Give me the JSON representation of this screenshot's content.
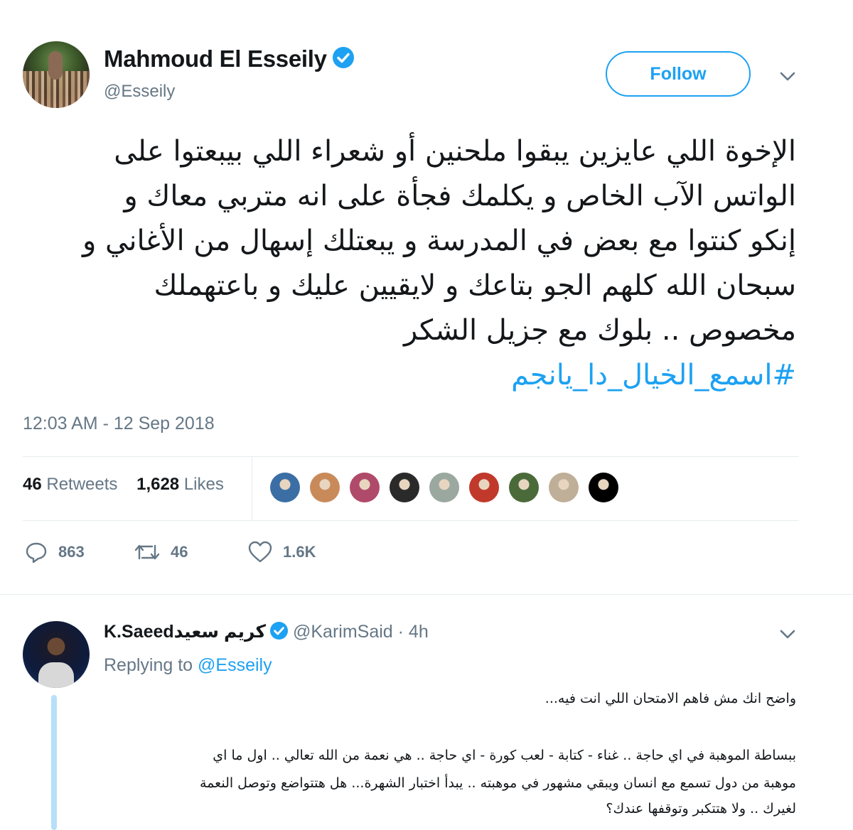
{
  "tweet": {
    "author_name": "Mahmoud El Esseily",
    "author_handle": "@Esseily",
    "follow_label": "Follow",
    "text_lines": [
      "الإخوة اللي عايزين يبقوا ملحنين أو شعراء اللي بيبعتوا على",
      "الواتس الآب الخاص و يكلمك فجأة على انه متربي معاك و",
      "إنكو كنتوا مع بعض في المدرسة و يبعتلك إسهال من الأغاني و",
      "سبحان الله كلهم الجو بتاعك و لايقيين عليك و باعتهملك",
      "مخصوص .. بلوك مع جزيل الشكر"
    ],
    "hashtag": "#اسمع_الخيال_دا_يانجم",
    "timestamp": "12:03 AM - 12 Sep 2018",
    "retweets_count": "46",
    "retweets_label": "Retweets",
    "likes_count": "1,628",
    "likes_label": "Likes",
    "actions": {
      "replies": "863",
      "retweets": "46",
      "likes": "1.6K"
    }
  },
  "likers": [
    {
      "color": "#3b6ea5"
    },
    {
      "color": "#c98a5a"
    },
    {
      "color": "#b04a6a"
    },
    {
      "color": "#2a2a2a"
    },
    {
      "color": "#9aa8a0"
    },
    {
      "color": "#c0392b"
    },
    {
      "color": "#4a6a3a"
    },
    {
      "color": "#bfae98"
    },
    {
      "color": "#000000"
    }
  ],
  "reply": {
    "author_name": "K.Saeedكريم سعيد",
    "author_handle": "@KarimSaid",
    "time": "· 4h",
    "replying_prefix": "Replying to ",
    "replying_handle": "@Esseily",
    "line1": "واضح انك مش فاهم الامتحان اللي انت فيه...",
    "line2": "ببساطة الموهبة في اي حاجة .. غناء - كتابة - لعب كورة - اي حاجة .. هي نعمة من الله تعالي .. اول ما اي",
    "line3": "موهبة من دول تسمع مع انسان ويبقي مشهور في موهبته .. يبدأ اختبار الشهرة... هل هتتواضع وتوصل النعمة",
    "line4": "لغيرك .. ولا هتتكبر وتوقفها عندك؟"
  },
  "colors": {
    "accent": "#1da1f2",
    "muted": "#657786",
    "text": "#14171a",
    "divider": "#e6ecf0"
  }
}
